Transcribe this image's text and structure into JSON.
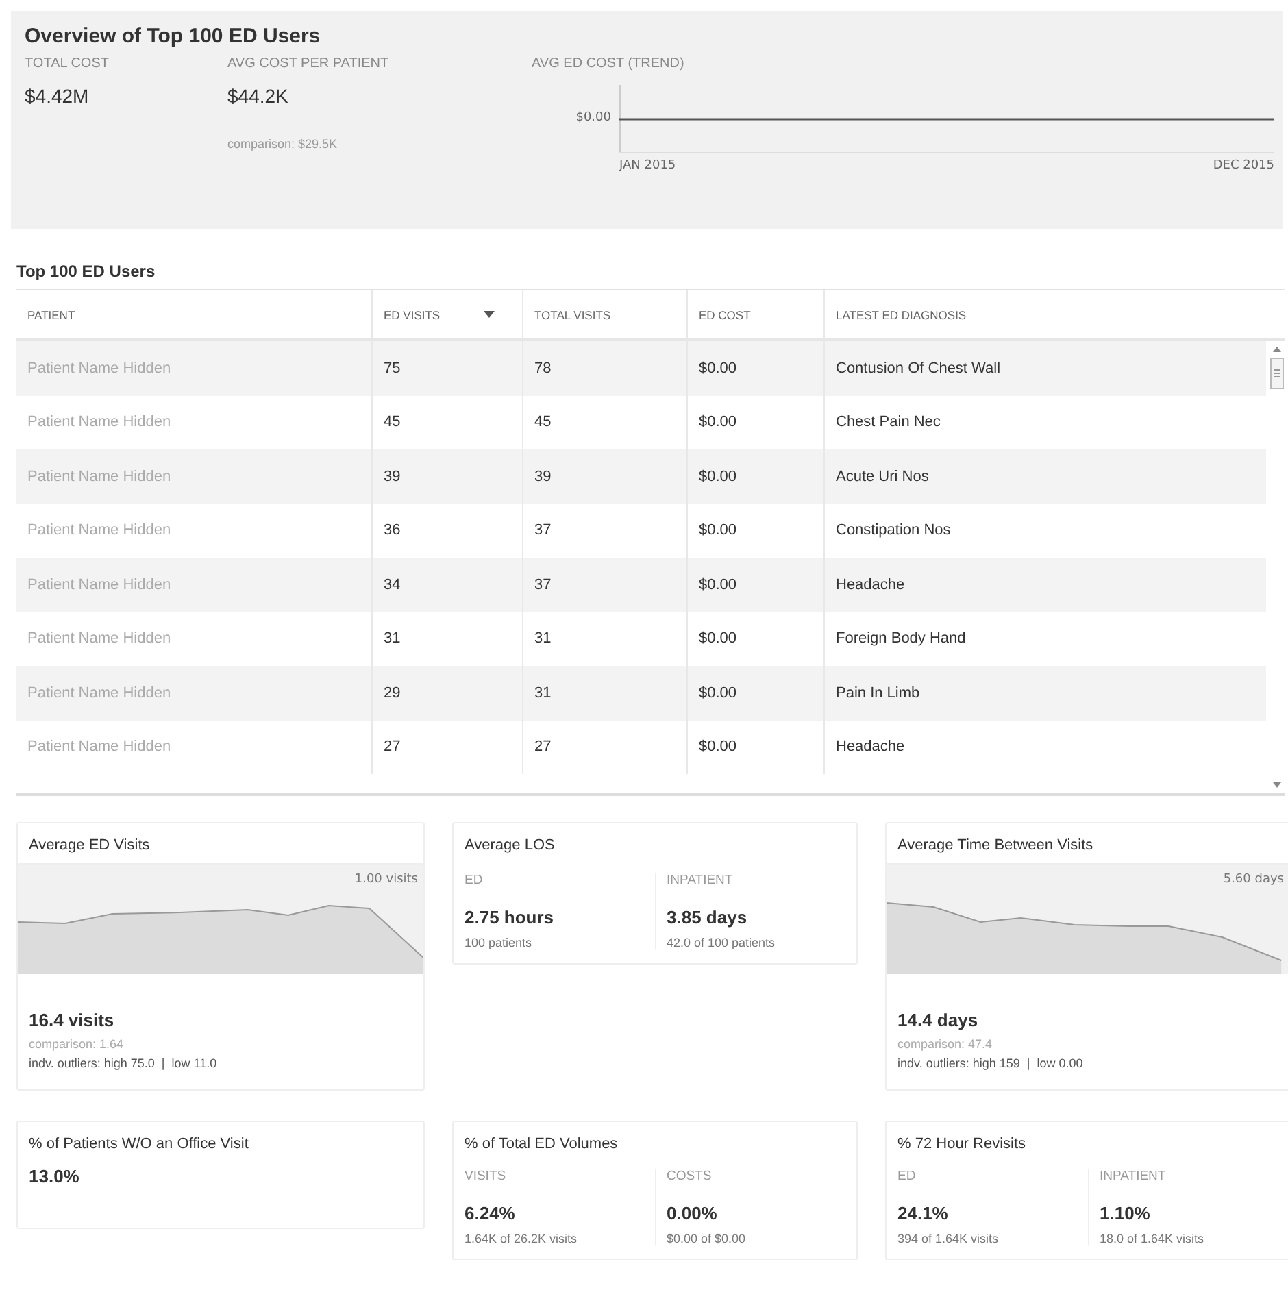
{
  "overview": {
    "title": "Overview of Top 100 ED Users",
    "metrics": [
      {
        "label": "TOTAL COST",
        "value": "$4.42M"
      },
      {
        "label": "AVG COST PER PATIENT",
        "value": "$44.2K",
        "comparison": "comparison: $29.5K"
      }
    ],
    "trend": {
      "label": "AVG ED COST (TREND)",
      "y_tick": "$0.00",
      "x_start": "JAN 2015",
      "x_end": "DEC 2015"
    }
  },
  "table": {
    "title": "Top 100 ED Users",
    "columns": [
      {
        "label": "PATIENT",
        "sorted": false
      },
      {
        "label": "ED VISITS",
        "sorted": true
      },
      {
        "label": "TOTAL VISITS",
        "sorted": false
      },
      {
        "label": "ED COST",
        "sorted": false
      },
      {
        "label": "LATEST ED DIAGNOSIS",
        "sorted": false
      }
    ],
    "rows": [
      [
        "Patient Name Hidden",
        "75",
        "78",
        "$0.00",
        "Contusion Of Chest Wall"
      ],
      [
        "Patient Name Hidden",
        "45",
        "45",
        "$0.00",
        "Chest Pain Nec"
      ],
      [
        "Patient Name Hidden",
        "39",
        "39",
        "$0.00",
        "Acute Uri Nos"
      ],
      [
        "Patient Name Hidden",
        "36",
        "37",
        "$0.00",
        "Constipation Nos"
      ],
      [
        "Patient Name Hidden",
        "34",
        "37",
        "$0.00",
        "Headache"
      ],
      [
        "Patient Name Hidden",
        "31",
        "31",
        "$0.00",
        "Foreign Body Hand"
      ],
      [
        "Patient Name Hidden",
        "29",
        "31",
        "$0.00",
        "Pain In Limb"
      ],
      [
        "Patient Name Hidden",
        "27",
        "27",
        "$0.00",
        "Headache"
      ]
    ]
  },
  "cards": [
    {
      "kind": "sparkline",
      "title": "Average ED Visits",
      "chart_label": "1.00 visits",
      "value": "16.4 visits",
      "comparison": "comparison: 1.64",
      "outliers": "indv. outliers: high 75.0  |  low 11.0"
    },
    {
      "kind": "split",
      "title": "Average LOS",
      "columns": [
        {
          "label": "ED",
          "value": "2.75 hours",
          "sub": "100 patients"
        },
        {
          "label": "INPATIENT",
          "value": "3.85 days",
          "sub": "42.0 of 100 patients"
        }
      ]
    },
    {
      "kind": "sparkline",
      "title": "Average Time Between Visits",
      "chart_label": "5.60 days",
      "value": "14.4 days",
      "comparison": "comparison: 47.4",
      "outliers": "indv. outliers: high 159  |  low 0.00"
    },
    {
      "kind": "single",
      "title": "% of Patients W/O an Office Visit",
      "value": "13.0%"
    },
    {
      "kind": "split",
      "title": "% of Total ED Volumes",
      "columns": [
        {
          "label": "VISITS",
          "value": "6.24%",
          "sub": "1.64K of 26.2K visits"
        },
        {
          "label": "COSTS",
          "value": "0.00%",
          "sub": "$0.00 of $0.00"
        }
      ]
    },
    {
      "kind": "split",
      "title": "% 72 Hour Revisits",
      "columns": [
        {
          "label": "ED",
          "value": "24.1%",
          "sub": "394 of 1.64K visits"
        },
        {
          "label": "INPATIENT",
          "value": "1.10%",
          "sub": "18.0 of 1.64K visits"
        }
      ]
    }
  ]
}
